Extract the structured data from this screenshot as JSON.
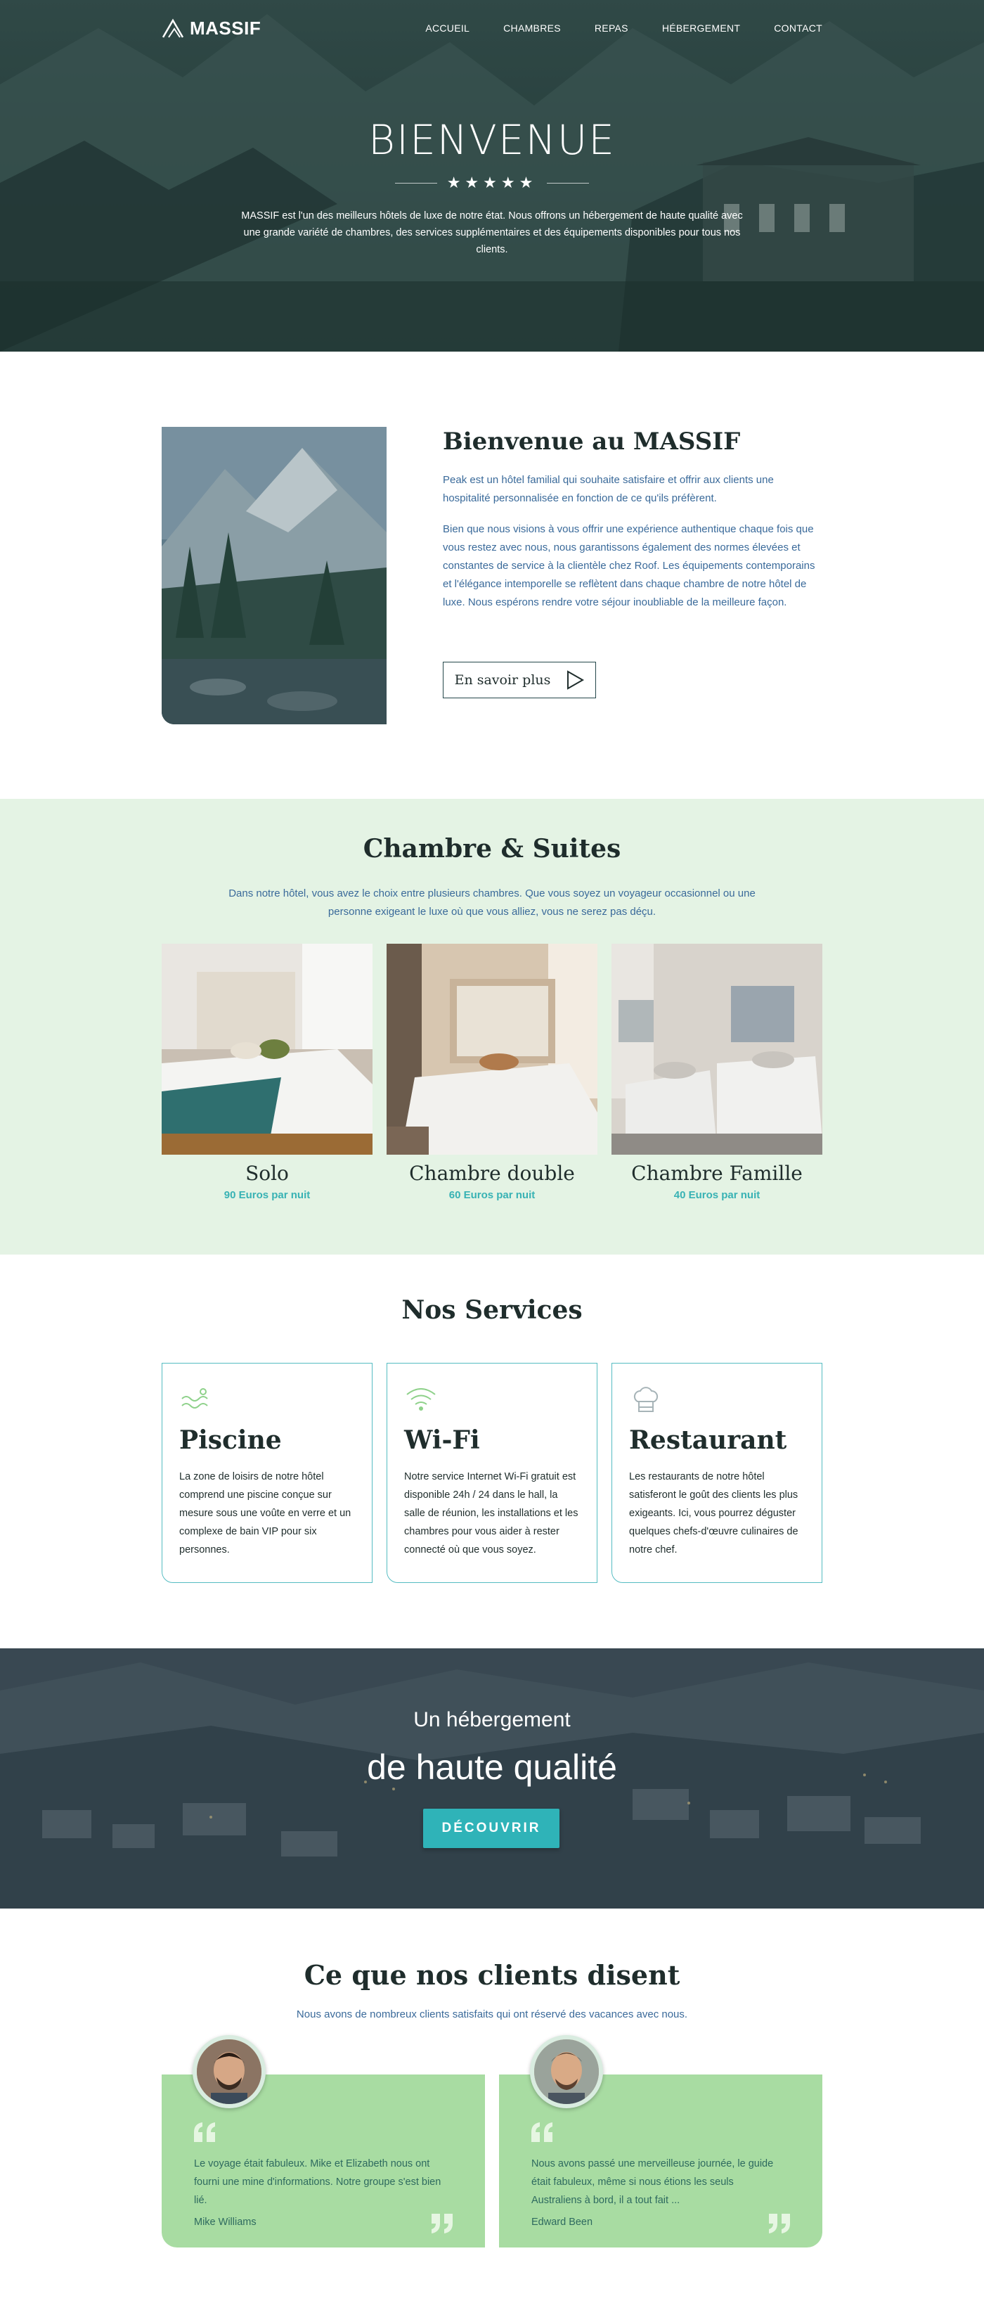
{
  "header": {
    "logo_text": "MASSIF",
    "menu": [
      "ACCUEIL",
      "CHAMBRES",
      "REPAS",
      "HÉBERGEMENT",
      "CONTACT"
    ]
  },
  "hero": {
    "title": "BIENVENUE",
    "stars": "★★★★★",
    "description": "MASSIF est l'un des meilleurs hôtels de luxe de notre état. Nous offrons un hébergement de haute qualité avec une grande variété de chambres, des services supplémentaires et des équipements disponibles pour tous nos clients."
  },
  "about": {
    "title": "Bienvenue au MASSIF",
    "paragraph1": "Peak est un hôtel familial qui souhaite satisfaire et offrir aux clients une hospitalité personnalisée en fonction de ce qu'ils préfèrent.",
    "paragraph2": "Bien que nous visions à vous offrir une expérience authentique chaque fois que vous restez avec nous, nous garantissons également des normes élevées et constantes de service à la clientèle chez Roof. Les équipements contemporains et l'élégance intemporelle se reflètent dans chaque chambre de notre hôtel de luxe. Nous espérons rendre votre séjour inoubliable de la meilleure façon.",
    "button_label": "En savoir plus"
  },
  "rooms": {
    "title": "Chambre & Suites",
    "description": "Dans notre hôtel, vous avez le choix entre plusieurs chambres. Que vous soyez un voyageur occasionnel ou une personne exigeant le luxe où que vous alliez, vous ne serez pas déçu.",
    "items": [
      {
        "name": "Solo",
        "price": "90 Euros par nuit"
      },
      {
        "name": "Chambre double",
        "price": "60 Euros par nuit"
      },
      {
        "name": "Chambre Famille",
        "price": "40 Euros par nuit"
      }
    ]
  },
  "services": {
    "title": "Nos Services",
    "items": [
      {
        "icon": "pool-icon",
        "title": "Piscine",
        "text": "La zone de loisirs de notre hôtel comprend une piscine conçue sur mesure sous une voûte en verre et un complexe de bain VIP pour six personnes."
      },
      {
        "icon": "wifi-icon",
        "title": "Wi-Fi",
        "text": "Notre service Internet Wi-Fi gratuit est disponible 24h / 24 dans le hall, la salle de réunion, les installations et les chambres pour vous aider à rester connecté où que vous soyez."
      },
      {
        "icon": "chef-hat-icon",
        "title": "Restaurant",
        "text": "Les restaurants de notre hôtel satisferont le goût des clients les plus exigeants. Ici, vous pourrez déguster quelques chefs-d'œuvre culinaires de notre chef."
      }
    ]
  },
  "banner": {
    "subtitle": "Un hébergement",
    "title": "de haute qualité",
    "button_label": "DÉCOUVRIR"
  },
  "testimonials": {
    "title": "Ce que nos clients disent",
    "description": "Nous avons de nombreux clients satisfaits qui ont réservé des vacances avec nous.",
    "items": [
      {
        "text": "Le voyage était fabuleux. Mike et Elizabeth nous ont fourni une mine d'informations. Notre groupe s'est bien lié.",
        "author": "Mike Williams"
      },
      {
        "text": "Nous avons passé une merveilleuse journée, le guide était fabuleux, même si nous étions les seuls Australiens à bord, il a tout fait ...",
        "author": "Edward Been"
      }
    ]
  },
  "colors": {
    "accent": "#2fb3b8",
    "text_blue": "#3a6a9a",
    "rooms_bg": "#e4f3e4",
    "testimonial_bg": "#a8dca2"
  }
}
